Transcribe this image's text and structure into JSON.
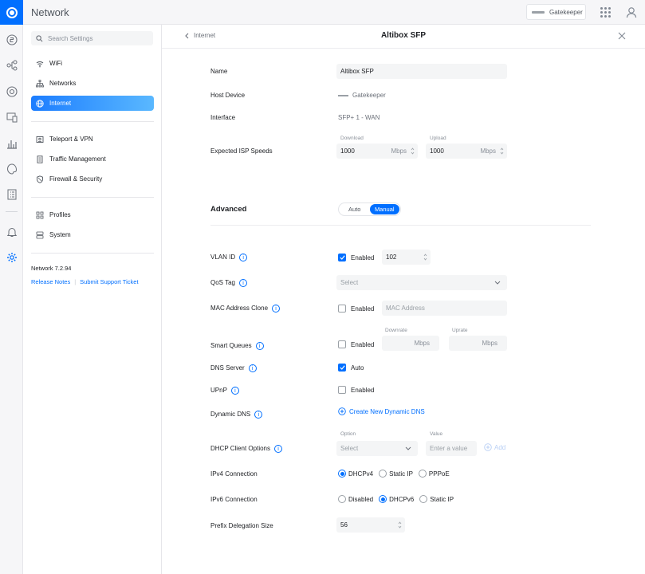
{
  "app": {
    "title": "Network"
  },
  "topbar": {
    "gateway_name": "Gatekeeper"
  },
  "sidebar": {
    "search_placeholder": "Search Settings",
    "items": [
      {
        "label": "WiFi",
        "icon": "wifi-icon"
      },
      {
        "label": "Networks",
        "icon": "networks-icon"
      },
      {
        "label": "Internet",
        "icon": "globe-icon",
        "active": true
      },
      {
        "label": "Teleport & VPN",
        "icon": "teleport-icon"
      },
      {
        "label": "Traffic Management",
        "icon": "traffic-icon"
      },
      {
        "label": "Firewall & Security",
        "icon": "shield-icon"
      },
      {
        "label": "Profiles",
        "icon": "profiles-icon"
      },
      {
        "label": "System",
        "icon": "system-icon"
      }
    ],
    "version": "Network 7.2.94",
    "release_notes": "Release Notes",
    "support": "Submit Support Ticket"
  },
  "header": {
    "back_label": "Internet",
    "title": "Altibox SFP"
  },
  "form": {
    "name_label": "Name",
    "name_value": "Altibox SFP",
    "host_label": "Host Device",
    "host_value": "Gatekeeper",
    "interface_label": "Interface",
    "interface_value": "SFP+ 1 - WAN",
    "isp_label": "Expected ISP Speeds",
    "download_label": "Download",
    "download_value": "1000",
    "upload_label": "Upload",
    "upload_value": "1000",
    "unit": "Mbps",
    "advanced_label": "Advanced",
    "mode_auto": "Auto",
    "mode_manual": "Manual",
    "vlan_label": "VLAN ID",
    "vlan_enabled": "Enabled",
    "vlan_value": "102",
    "qos_label": "QoS Tag",
    "qos_placeholder": "Select",
    "mac_label": "MAC Address Clone",
    "mac_enabled": "Enabled",
    "mac_placeholder": "MAC Address",
    "sq_label": "Smart Queues",
    "sq_enabled": "Enabled",
    "downrate_label": "Downrate",
    "uprate_label": "Uprate",
    "dns_label": "DNS Server",
    "dns_auto": "Auto",
    "upnp_label": "UPnP",
    "upnp_enabled": "Enabled",
    "ddns_label": "Dynamic DNS",
    "ddns_link": "Create New Dynamic DNS",
    "dhcp_label": "DHCP Client Options",
    "option_label": "Option",
    "option_placeholder": "Select",
    "value_label": "Value",
    "value_placeholder": "Enter a value",
    "add_label": "Add",
    "ipv4_label": "IPv4 Connection",
    "ipv4_opts": [
      "DHCPv4",
      "Static IP",
      "PPPoE"
    ],
    "ipv6_label": "IPv6 Connection",
    "ipv6_opts": [
      "Disabled",
      "DHCPv6",
      "Static IP"
    ],
    "pd_label": "Prefix Delegation Size",
    "pd_value": "56"
  }
}
